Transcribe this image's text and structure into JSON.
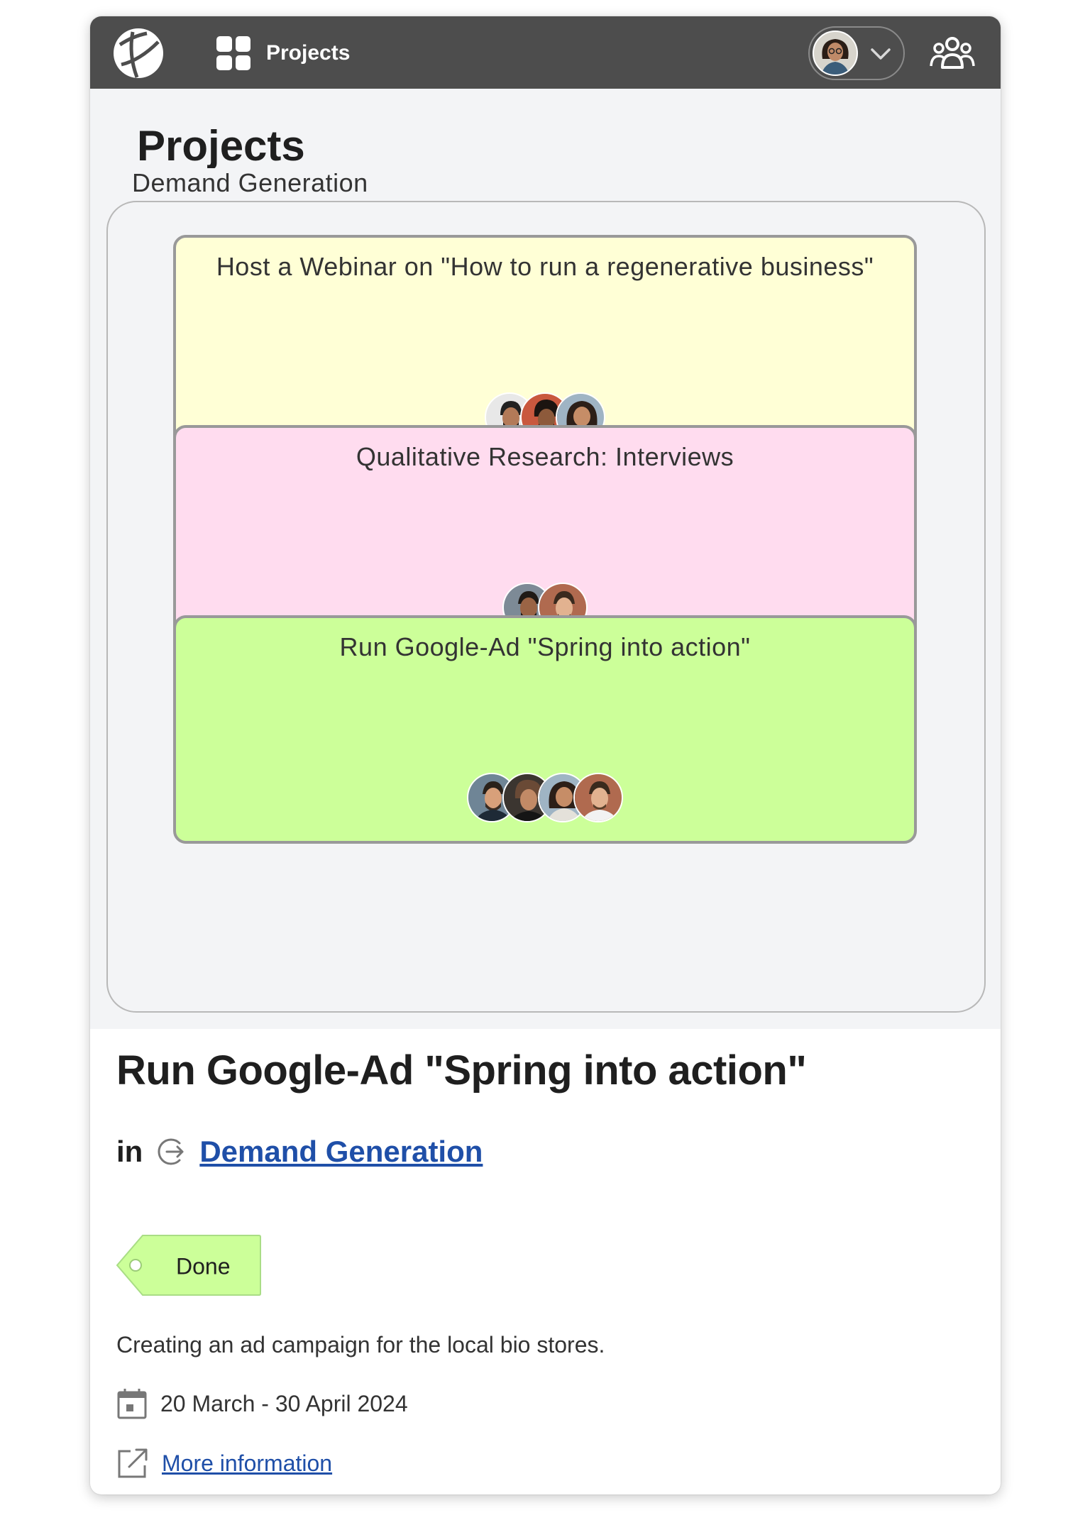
{
  "topbar": {
    "nav_label": "Projects",
    "icons": [
      "app-logo-icon",
      "grid-icon",
      "profile-avatar",
      "chevron-down-icon",
      "team-icon"
    ]
  },
  "page": {
    "title": "Projects"
  },
  "group": {
    "name": "Demand Generation"
  },
  "cards": [
    {
      "title": "Host a Webinar on \"How to run a regenerative business\"",
      "color": "#ffffd6",
      "members": 3
    },
    {
      "title": "Qualitative Research: Interviews",
      "color": "#ffdcef",
      "members": 2
    },
    {
      "title": "Run Google-Ad \"Spring into action\"",
      "color": "#ccff99",
      "members": 4
    }
  ],
  "detail": {
    "title": "Run Google-Ad \"Spring into action\"",
    "in_label": "in",
    "group_link": "Demand Generation",
    "status": "Done",
    "status_color": "#ccff99",
    "description": "Creating an ad campaign for the local bio stores.",
    "dates": "20 March - 30 April 2024",
    "more_link": "More information"
  },
  "colors": {
    "topbar": "#4d4d4d",
    "board_bg": "#f3f4f6",
    "link": "#1f4fa8"
  }
}
